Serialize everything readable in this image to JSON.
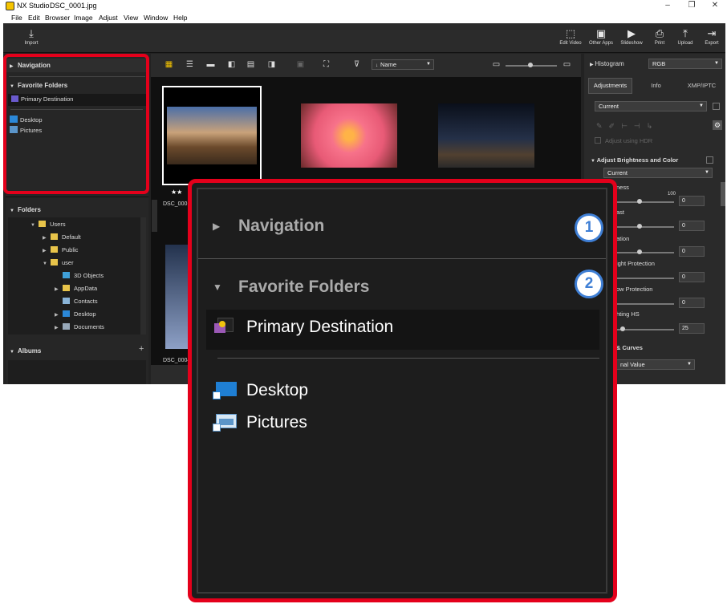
{
  "window": {
    "app": "NX Studio",
    "file": "DSC_0001.jpg"
  },
  "menu": [
    "File",
    "Edit",
    "Browser",
    "Image",
    "Adjust",
    "View",
    "Window",
    "Help"
  ],
  "toolbar": {
    "import": "Import",
    "edit_video": "Edit Video",
    "other_apps": "Other Apps",
    "slideshow": "Slideshow",
    "print": "Print",
    "upload": "Upload",
    "export": "Export"
  },
  "left": {
    "navigation": "Navigation",
    "favorite_folders": "Favorite Folders",
    "primary_destination": "Primary Destination",
    "desktop": "Desktop",
    "pictures": "Pictures",
    "folders": "Folders",
    "tree": [
      "Users",
      "Default",
      "Public",
      "user",
      "3D Objects",
      "AppData",
      "Contacts",
      "Desktop",
      "Documents"
    ],
    "albums": "Albums"
  },
  "center": {
    "sort": "Name",
    "thumb1_label": "DSC_0001",
    "thumb2_label": "DSC_0004",
    "stars": "★★"
  },
  "right": {
    "histogram": "Histogram",
    "channel": "RGB",
    "tabs": [
      "Adjustments",
      "Info",
      "XMP/IPTC"
    ],
    "preset": "Current",
    "adjust_hdr": "Adjust using HDR",
    "brightness_section": "Adjust Brightness and Color",
    "brightness_preset": "Current",
    "rows": [
      "ness",
      "ast",
      "ation",
      "ight Protection",
      "ow Protection",
      "hting HS"
    ],
    "values": [
      "0",
      "0",
      "0",
      "0",
      "0",
      "25"
    ],
    "max": "100",
    "curves": "& Curves",
    "tonal": "nal Value"
  },
  "callout": {
    "navigation": "Navigation",
    "favorite_folders": "Favorite Folders",
    "primary_destination": "Primary Destination",
    "desktop": "Desktop",
    "pictures": "Pictures",
    "badge1": "1",
    "badge2": "2"
  },
  "colors": {
    "highlight": "#e4001b",
    "badge": "#3f7fd5",
    "folder": "#e8c44a"
  }
}
